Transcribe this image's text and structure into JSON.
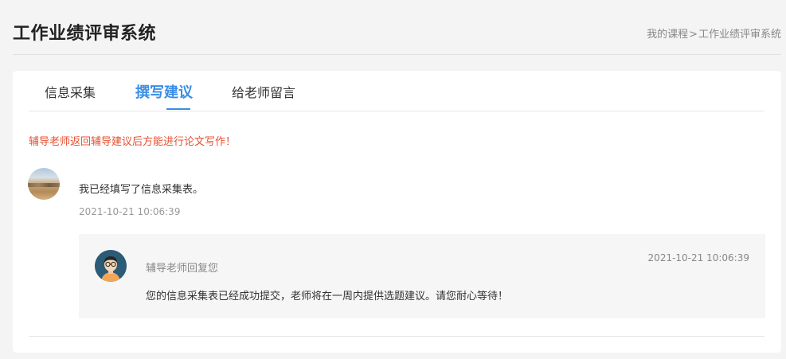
{
  "header": {
    "title": "工作业绩评审系统",
    "breadcrumb": [
      "我的课程",
      "工作业绩评审系统"
    ],
    "breadcrumb_sep": ">"
  },
  "tabs": [
    {
      "label": "信息采集",
      "active": false
    },
    {
      "label": "撰写建议",
      "active": true
    },
    {
      "label": "给老师留言",
      "active": false
    }
  ],
  "notice": "辅导老师返回辅导建议后方能进行论文写作！",
  "message": {
    "text": "我已经填写了信息采集表。",
    "time": "2021-10-21 10:06:39"
  },
  "reply": {
    "name": "辅导老师回复您",
    "time": "2021-10-21 10:06:39",
    "text": "您的信息采集表已经成功提交，老师将在一周内提供选题建议。请您耐心等待！"
  },
  "colors": {
    "accent": "#3a8ee6",
    "notice": "#e8502f"
  }
}
